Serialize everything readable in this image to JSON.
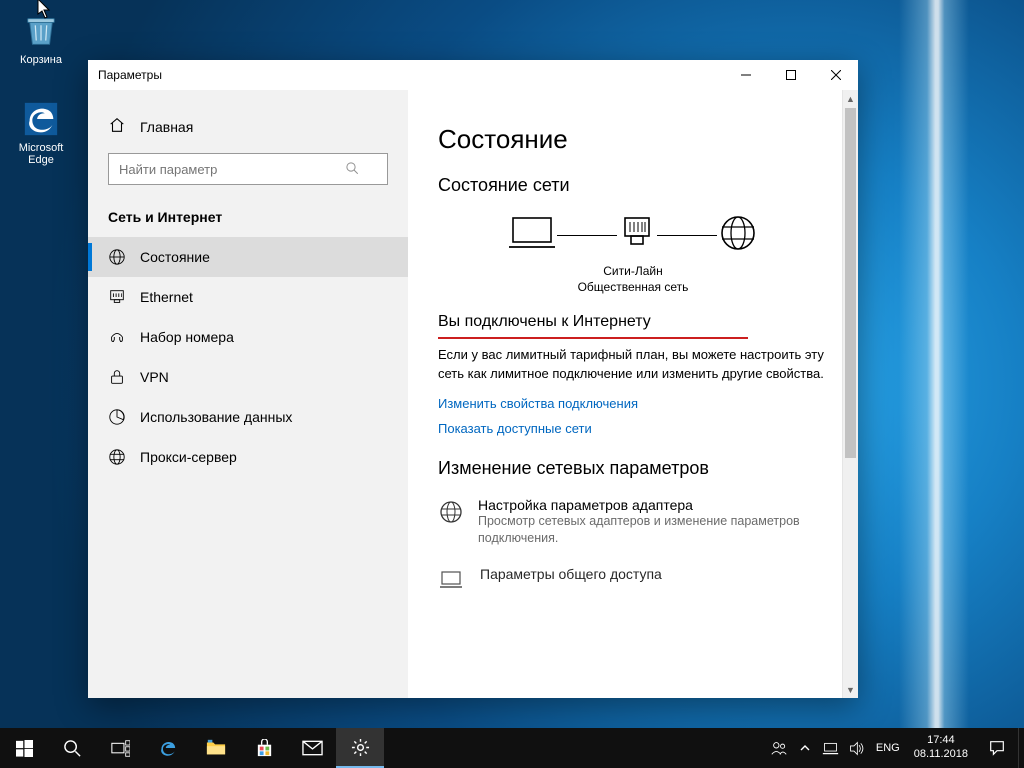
{
  "desktop": {
    "icons": {
      "recycle": "Корзина",
      "edge": "Microsoft Edge"
    }
  },
  "window": {
    "title": "Параметры",
    "home": "Главная",
    "search_placeholder": "Найти параметр",
    "category": "Сеть и Интернет",
    "nav": [
      {
        "key": "status",
        "label": "Состояние"
      },
      {
        "key": "ethernet",
        "label": "Ethernet"
      },
      {
        "key": "dialup",
        "label": "Набор номера"
      },
      {
        "key": "vpn",
        "label": "VPN"
      },
      {
        "key": "datausage",
        "label": "Использование данных"
      },
      {
        "key": "proxy",
        "label": "Прокси-сервер"
      }
    ]
  },
  "main": {
    "h1": "Состояние",
    "h2": "Состояние сети",
    "diagram": {
      "conn_name": "Сити-Лайн",
      "conn_type": "Общественная сеть"
    },
    "connected_heading": "Вы подключены к Интернету",
    "connected_body": "Если у вас лимитный тарифный план, вы можете настроить эту сеть как лимитное подключение или изменить другие свойства.",
    "link_change_props": "Изменить свойства подключения",
    "link_show_networks": "Показать доступные сети",
    "section_change": "Изменение сетевых параметров",
    "adapter": {
      "title": "Настройка параметров адаптера",
      "desc": "Просмотр сетевых адаптеров и изменение параметров подключения."
    },
    "sharing_title": "Параметры общего доступа"
  },
  "taskbar": {
    "lang": "ENG",
    "time": "17:44",
    "date": "08.11.2018"
  }
}
